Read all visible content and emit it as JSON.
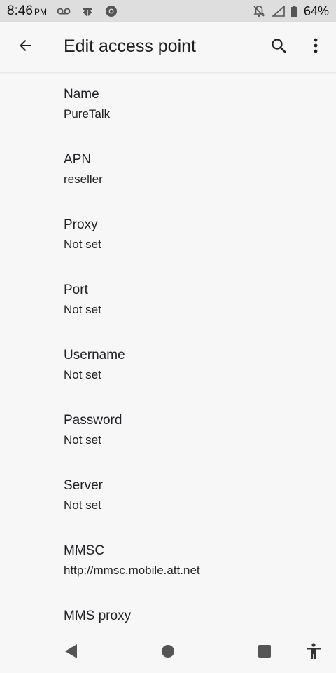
{
  "status_bar": {
    "time": "8:46",
    "ampm": "PM",
    "battery": "64%",
    "icons": [
      "voicemail-icon",
      "bug-icon",
      "chrome-icon",
      "notifications-off-icon",
      "signal-icon",
      "battery-icon"
    ]
  },
  "app_bar": {
    "title": "Edit access point",
    "back_icon": "arrow-back-icon",
    "search_icon": "search-icon",
    "more_icon": "more-vert-icon"
  },
  "preferences": [
    {
      "title": "Name",
      "summary": "PureTalk"
    },
    {
      "title": "APN",
      "summary": "reseller"
    },
    {
      "title": "Proxy",
      "summary": "Not set"
    },
    {
      "title": "Port",
      "summary": "Not set"
    },
    {
      "title": "Username",
      "summary": "Not set"
    },
    {
      "title": "Password",
      "summary": "Not set"
    },
    {
      "title": "Server",
      "summary": "Not set"
    },
    {
      "title": "MMSC",
      "summary": "http://mmsc.mobile.att.net"
    },
    {
      "title": "MMS proxy",
      "summary": ""
    }
  ],
  "nav_bar": {
    "icons": [
      "back-triangle-icon",
      "home-circle-icon",
      "recents-square-icon",
      "accessibility-icon"
    ]
  }
}
